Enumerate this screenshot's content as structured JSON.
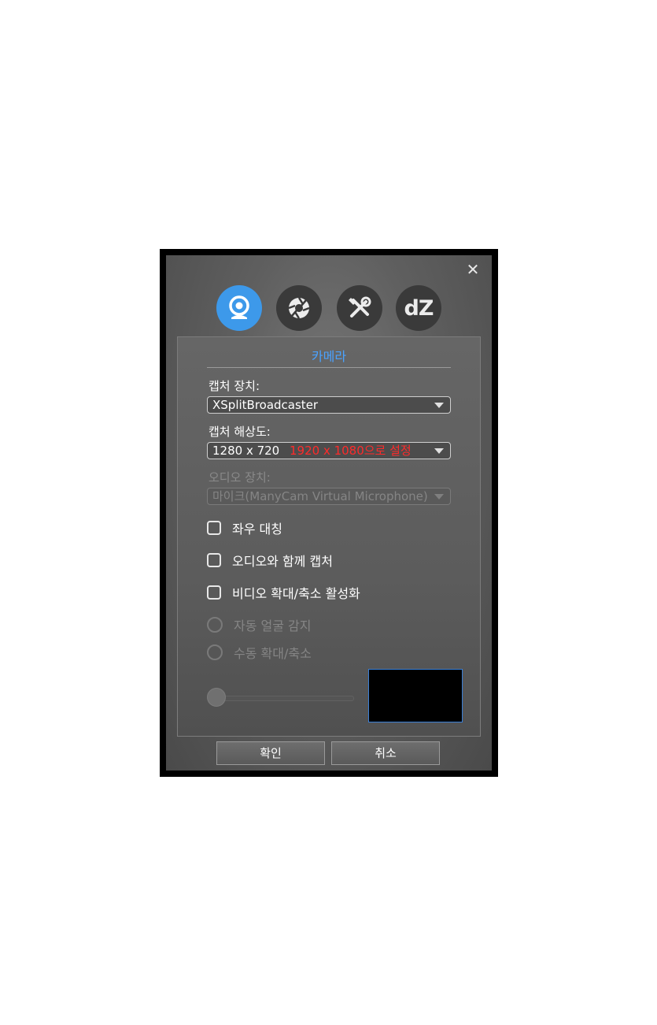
{
  "window": {
    "close_glyph": "✕"
  },
  "tabs": [
    {
      "name": "webcam-icon",
      "active": true
    },
    {
      "name": "aperture-icon",
      "active": false
    },
    {
      "name": "tools-icon",
      "active": false
    },
    {
      "name": "dz-logo-icon",
      "label": "dZ",
      "active": false
    }
  ],
  "panel": {
    "title": "카메라",
    "capture_device": {
      "label": "캡처 장치:",
      "value": "XSplitBroadcaster"
    },
    "capture_resolution": {
      "label": "캡처 해상도:",
      "value": "1280 x 720",
      "annotation": "1920 x 1080으로 설정"
    },
    "audio_device": {
      "label": "오디오 장치:",
      "value": "마이크(ManyCam Virtual Microphone)",
      "disabled": true
    },
    "checkboxes": [
      {
        "label": "좌우 대칭",
        "checked": false
      },
      {
        "label": "오디오와 함께 캡처",
        "checked": false
      },
      {
        "label": "비디오 확대/축소 활성화",
        "checked": false
      }
    ],
    "radios": [
      {
        "label": "자동 얼굴 감지",
        "disabled": true
      },
      {
        "label": "수동 확대/축소",
        "disabled": true
      }
    ],
    "zoom_slider": {
      "value": 0
    }
  },
  "footer": {
    "ok_label": "확인",
    "cancel_label": "취소"
  },
  "colors": {
    "accent": "#3d99ea",
    "title": "#4aa2ff",
    "annotation": "#ff2a2a"
  }
}
